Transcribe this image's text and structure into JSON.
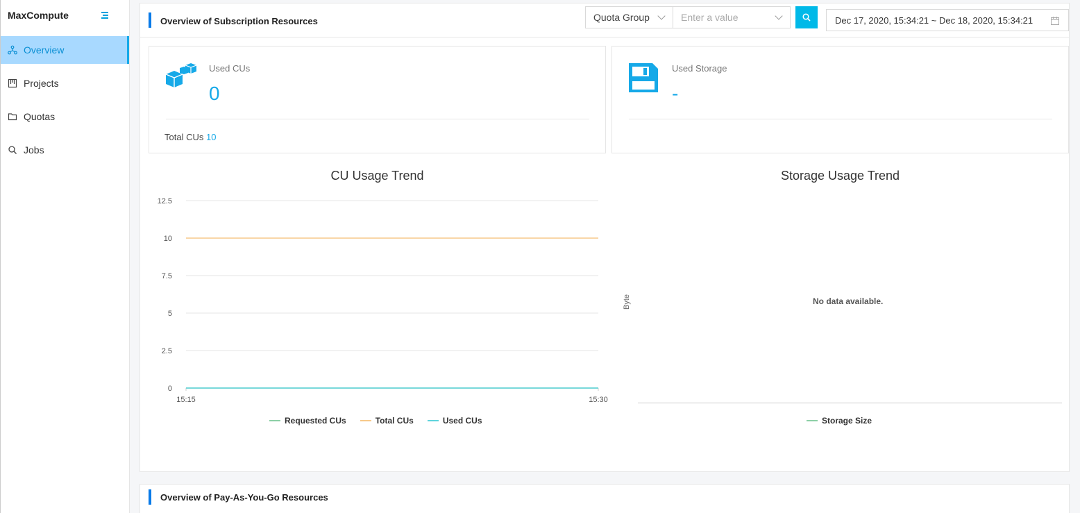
{
  "app": {
    "name": "MaxCompute"
  },
  "sidebar": {
    "items": [
      {
        "label": "Overview",
        "icon": "overview-icon",
        "active": true
      },
      {
        "label": "Projects",
        "icon": "projects-icon",
        "active": false
      },
      {
        "label": "Quotas",
        "icon": "folder-icon",
        "active": false
      },
      {
        "label": "Jobs",
        "icon": "search-icon",
        "active": false
      }
    ]
  },
  "subscription": {
    "title": "Overview of Subscription Resources",
    "filter": {
      "select_value": "Quota Group",
      "input_placeholder": "Enter a value"
    },
    "date_range": "Dec 17, 2020, 15:34:21 ~ Dec 18, 2020, 15:34:21",
    "cu_card": {
      "label": "Used CUs",
      "value": "0",
      "footer_label": "Total CUs",
      "footer_value": "10"
    },
    "storage_card": {
      "label": "Used Storage",
      "value": "-"
    },
    "cu_chart": {
      "title": "CU Usage Trend"
    },
    "storage_chart": {
      "title": "Storage Usage Trend",
      "ylabel": "Byte",
      "empty_text": "No data available.",
      "legend": "Storage Size"
    }
  },
  "payg": {
    "title": "Overview of Pay-As-You-Go Resources"
  },
  "colors": {
    "accent": "#16a9e8",
    "requested": "#8dcfa6",
    "total": "#f7c98a",
    "used": "#5fd4dc"
  },
  "chart_data": [
    {
      "type": "line",
      "title": "CU Usage Trend",
      "x": [
        "15:15",
        "15:30"
      ],
      "yticks": [
        0,
        2.5,
        5,
        7.5,
        10,
        12.5
      ],
      "ylim": [
        0,
        12.5
      ],
      "series": [
        {
          "name": "Requested CUs",
          "values": [
            0,
            0
          ],
          "color": "#8dcfa6"
        },
        {
          "name": "Total CUs",
          "values": [
            10,
            10
          ],
          "color": "#f7c98a"
        },
        {
          "name": "Used CUs",
          "values": [
            0,
            0
          ],
          "color": "#5fd4dc"
        }
      ]
    },
    {
      "type": "line",
      "title": "Storage Usage Trend",
      "ylabel": "Byte",
      "series": [
        {
          "name": "Storage Size",
          "values": [],
          "color": "#8dcfa6"
        }
      ]
    }
  ]
}
